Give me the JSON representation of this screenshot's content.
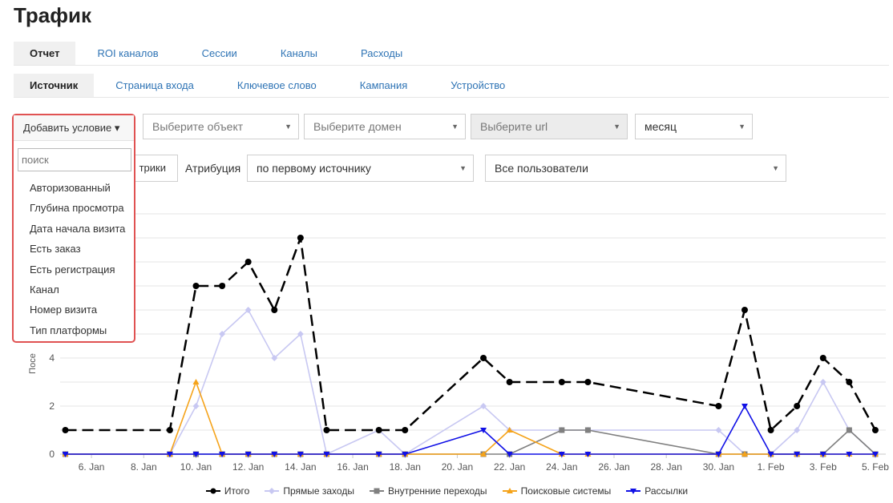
{
  "page": {
    "title": "Трафик"
  },
  "tabs_main": [
    {
      "label": "Отчет",
      "active": true
    },
    {
      "label": "ROI каналов",
      "active": false
    },
    {
      "label": "Сессии",
      "active": false
    },
    {
      "label": "Каналы",
      "active": false
    },
    {
      "label": "Расходы",
      "active": false
    }
  ],
  "tabs_dimension": [
    {
      "label": "Источник",
      "active": true
    },
    {
      "label": "Страница входа",
      "active": false
    },
    {
      "label": "Ключевое слово",
      "active": false
    },
    {
      "label": "Кампания",
      "active": false
    },
    {
      "label": "Устройство",
      "active": false
    }
  ],
  "filters": {
    "add_condition": "Добавить условие ▾",
    "object": "Выберите объект",
    "domain": "Выберите домен",
    "url": "Выберите url",
    "period": "месяц",
    "metrics_button": "трики",
    "attribution_label": "Атрибуция",
    "attribution_value": "по первому источнику",
    "users_value": "Все пользователи"
  },
  "dropdown": {
    "search_placeholder": "поиск",
    "items": [
      "Авторизованный",
      "Глубина просмотра",
      "Дата начала визита",
      "Есть заказ",
      "Есть регистрация",
      "Канал",
      "Номер визита",
      "Тип платформы"
    ]
  },
  "chart_data": {
    "type": "line",
    "ylabel": "Посе",
    "yticks": [
      0,
      2,
      4
    ],
    "xtick_labels": [
      "6. Jan",
      "8. Jan",
      "10. Jan",
      "12. Jan",
      "14. Jan",
      "16. Jan",
      "18. Jan",
      "20. Jan",
      "22. Jan",
      "24. Jan",
      "26. Jan",
      "28. Jan",
      "30. Jan",
      "1. Feb",
      "3. Feb",
      "5. Feb"
    ],
    "xtick_positions": [
      6,
      8,
      10,
      12,
      14,
      16,
      18,
      20,
      22,
      24,
      26,
      28,
      30,
      32,
      34,
      36
    ],
    "xlim": [
      4.8,
      36.4
    ],
    "ylim": [
      0,
      10
    ],
    "series": [
      {
        "name": "Итого",
        "color": "#000000",
        "style": "dashed",
        "marker": "circle",
        "points": [
          [
            5,
            1
          ],
          [
            9,
            1
          ],
          [
            10,
            7
          ],
          [
            11,
            7
          ],
          [
            12,
            8
          ],
          [
            13,
            6
          ],
          [
            14,
            9
          ],
          [
            15,
            1
          ],
          [
            17,
            1
          ],
          [
            18,
            1
          ],
          [
            21,
            4
          ],
          [
            22,
            3
          ],
          [
            24,
            3
          ],
          [
            25,
            3
          ],
          [
            30,
            2
          ],
          [
            31,
            6
          ],
          [
            32,
            1
          ],
          [
            33,
            2
          ],
          [
            34,
            4
          ],
          [
            35,
            3
          ],
          [
            36,
            1
          ]
        ]
      },
      {
        "name": "Прямые заходы",
        "color": "#c8c8f2",
        "style": "solid",
        "marker": "diamond",
        "points": [
          [
            5,
            0
          ],
          [
            9,
            0
          ],
          [
            10,
            2
          ],
          [
            11,
            5
          ],
          [
            12,
            6
          ],
          [
            13,
            4
          ],
          [
            14,
            5
          ],
          [
            15,
            0
          ],
          [
            17,
            1
          ],
          [
            18,
            0
          ],
          [
            21,
            2
          ],
          [
            22,
            1
          ],
          [
            24,
            1
          ],
          [
            25,
            1
          ],
          [
            30,
            1
          ],
          [
            31,
            0
          ],
          [
            32,
            0
          ],
          [
            33,
            1
          ],
          [
            34,
            3
          ],
          [
            35,
            1
          ],
          [
            36,
            0
          ]
        ]
      },
      {
        "name": "Внутренние переходы",
        "color": "#808080",
        "style": "solid",
        "marker": "square",
        "points": [
          [
            5,
            0
          ],
          [
            9,
            0
          ],
          [
            10,
            0
          ],
          [
            11,
            0
          ],
          [
            12,
            0
          ],
          [
            13,
            0
          ],
          [
            14,
            0
          ],
          [
            15,
            0
          ],
          [
            17,
            0
          ],
          [
            18,
            0
          ],
          [
            21,
            0
          ],
          [
            22,
            0
          ],
          [
            24,
            1
          ],
          [
            25,
            1
          ],
          [
            30,
            0
          ],
          [
            31,
            0
          ],
          [
            32,
            0
          ],
          [
            33,
            0
          ],
          [
            34,
            0
          ],
          [
            35,
            1
          ],
          [
            36,
            0
          ]
        ]
      },
      {
        "name": "Поисковые системы",
        "color": "#f5a31a",
        "style": "solid",
        "marker": "triangle",
        "points": [
          [
            5,
            0
          ],
          [
            9,
            0
          ],
          [
            10,
            3
          ],
          [
            11,
            0
          ],
          [
            12,
            0
          ],
          [
            13,
            0
          ],
          [
            14,
            0
          ],
          [
            15,
            0
          ],
          [
            17,
            0
          ],
          [
            18,
            0
          ],
          [
            21,
            0
          ],
          [
            22,
            1
          ],
          [
            24,
            0
          ],
          [
            25,
            0
          ],
          [
            30,
            0
          ],
          [
            31,
            0
          ],
          [
            32,
            0
          ],
          [
            33,
            0
          ],
          [
            34,
            0
          ],
          [
            35,
            0
          ],
          [
            36,
            0
          ]
        ]
      },
      {
        "name": "Рассылки",
        "color": "#1010e6",
        "style": "solid",
        "marker": "triangle-down",
        "points": [
          [
            5,
            0
          ],
          [
            9,
            0
          ],
          [
            10,
            0
          ],
          [
            11,
            0
          ],
          [
            12,
            0
          ],
          [
            13,
            0
          ],
          [
            14,
            0
          ],
          [
            15,
            0
          ],
          [
            17,
            0
          ],
          [
            18,
            0
          ],
          [
            21,
            1
          ],
          [
            22,
            0
          ],
          [
            24,
            0
          ],
          [
            25,
            0
          ],
          [
            30,
            0
          ],
          [
            31,
            2
          ],
          [
            32,
            0
          ],
          [
            33,
            0
          ],
          [
            34,
            0
          ],
          [
            35,
            0
          ],
          [
            36,
            0
          ]
        ]
      }
    ]
  }
}
